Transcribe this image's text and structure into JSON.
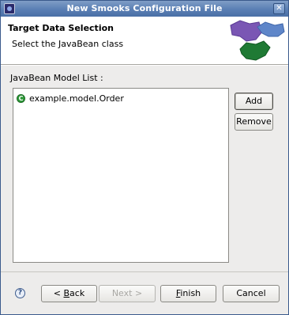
{
  "window": {
    "title": "New Smooks Configuration File"
  },
  "header": {
    "title": "Target Data Selection",
    "description": "Select the JavaBean class"
  },
  "list": {
    "label": "JavaBean Model List :",
    "items": [
      {
        "text": "example.model.Order"
      }
    ]
  },
  "side_buttons": {
    "add": "Add",
    "remove": "Remove"
  },
  "footer": {
    "back_prefix": "< ",
    "back_mnemonic": "B",
    "back_rest": "ack",
    "next": "Next >",
    "finish_mnemonic": "F",
    "finish_rest": "inish",
    "cancel": "Cancel"
  },
  "colors": {
    "title_bar": "#5a7fb4",
    "class_icon": "#2f9a3a"
  }
}
